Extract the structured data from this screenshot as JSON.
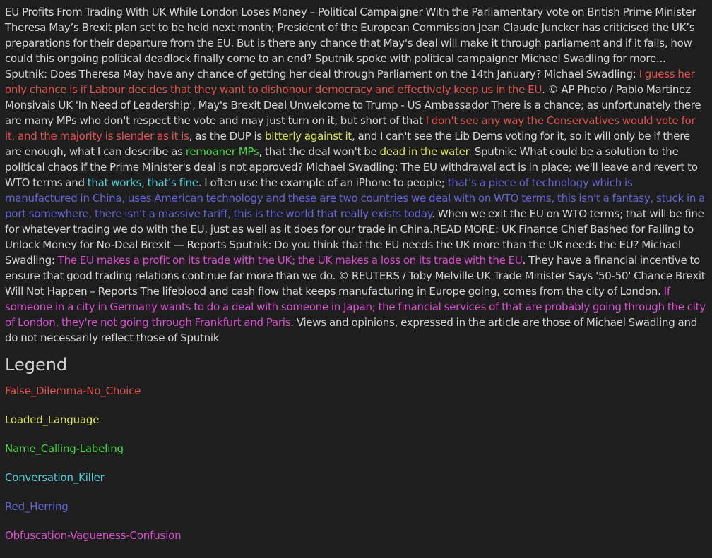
{
  "colors": {
    "background": "#1e1e1e",
    "plain_text": "#d4d4d4",
    "False_Dilemma-No_Choice": "#e0524f",
    "Loaded_Language": "#dbe35a",
    "Name_Calling-Labeling": "#4cd44c",
    "Conversation_Killer": "#4cd0d8",
    "Red_Herring": "#6464d4",
    "Obfuscation-Vagueness-Confusion": "#d94fd1"
  },
  "article": {
    "segments": [
      {
        "type": "plain",
        "text": "EU Profits From Trading With UK While London Loses Money – Political Campaigner With the Parliamentary vote on British Prime Minister Theresa May’s Brexit plan set to be held next month; President of the European Commission Jean Claude Juncker has criticised the UK’s preparations for their departure from the EU. But is there any chance that May's deal will make it through parliament and if it fails, how could this ongoing political deadlock finally come to an end? Sputnik spoke with political campaigner Michael Swadling for more... Sputnik: Does Theresa May have any chance of getting her deal through Parliament on the 14th January? Michael Swadling: "
      },
      {
        "type": "false_dilemma",
        "text": "I guess her only chance is if Labour decides that they want to dishonour democracy and effectively keep us in the EU"
      },
      {
        "type": "plain",
        "text": ". © AP Photo / Pablo Martinez Monsivais UK 'In Need of Leadership', May's Brexit Deal Unwelcome to Trump - US Ambassador There is a chance; as unfortunately there are many MPs who don't respect the vote and may just turn on it, but short of that "
      },
      {
        "type": "false_dilemma",
        "text": "I don't see any way the Conservatives would vote for it, and the majority is slender as it is"
      },
      {
        "type": "plain",
        "text": ", as the DUP is "
      },
      {
        "type": "loaded_language",
        "text": "bitterly against it"
      },
      {
        "type": "plain",
        "text": ", and I can't see the Lib Dems voting for it, so it will only be if there are enough, what I can describe as "
      },
      {
        "type": "name_calling",
        "text": "remoaner MPs"
      },
      {
        "type": "plain",
        "text": ", that the deal won't be "
      },
      {
        "type": "loaded_language",
        "text": "dead in the water"
      },
      {
        "type": "plain",
        "text": ". Sputnik: What could be a solution to the political chaos if the Prime Minister's deal is not approved? Michael Swadling: The EU withdrawal act is in place; we'll leave and revert to WTO terms and "
      },
      {
        "type": "conversation_killer",
        "text": "that works, that's fine"
      },
      {
        "type": "plain",
        "text": ". I often use the example of an iPhone to people; "
      },
      {
        "type": "red_herring",
        "text": "that's a piece of technology which is manufactured in China, uses American technology and these are two countries we deal with on WTO terms, this isn't a fantasy, stuck in a port somewhere, there isn't a massive tariff, this is the world that really exists today"
      },
      {
        "type": "plain",
        "text": ". When we exit the EU on WTO terms; that will be fine for whatever trading we do with the EU, just as well as it does for our trade in China.READ MORE: UK Finance Chief Bashed for Failing to Unlock Money for No-Deal Brexit — Reports Sputnik: Do you think that the EU needs the UK more than the UK needs the EU? Michael Swadling: "
      },
      {
        "type": "obfuscation",
        "text": "The EU makes a profit on its trade with the UK; the UK makes a loss on its trade with the EU"
      },
      {
        "type": "plain",
        "text": ". They have a financial incentive to ensure that good trading relations continue far more than we do. © REUTERS / Toby Melville UK Trade Minister Says '50-50' Chance Brexit Will Not Happen – Reports The lifeblood and cash flow that keeps manufacturing in Europe going, comes from the city of London. "
      },
      {
        "type": "obfuscation",
        "text": "If someone in a city in Germany wants to do a deal with someone in Japan; the financial services of that are probably going through the city of London, they're not going through Frankfurt and Paris"
      },
      {
        "type": "plain",
        "text": ". Views and opinions, expressed in the article are those of Michael Swadling and do not necessarily reflect those of Sputnik"
      }
    ]
  },
  "legend": {
    "title": "Legend",
    "items": [
      {
        "label": "False_Dilemma-No_Choice",
        "color": "#e0524f"
      },
      {
        "label": "Loaded_Language",
        "color": "#dbe35a"
      },
      {
        "label": "Name_Calling-Labeling",
        "color": "#4cd44c"
      },
      {
        "label": "Conversation_Killer",
        "color": "#4cd0d8"
      },
      {
        "label": "Red_Herring",
        "color": "#6464d4"
      },
      {
        "label": "Obfuscation-Vagueness-Confusion",
        "color": "#d94fd1"
      }
    ]
  }
}
